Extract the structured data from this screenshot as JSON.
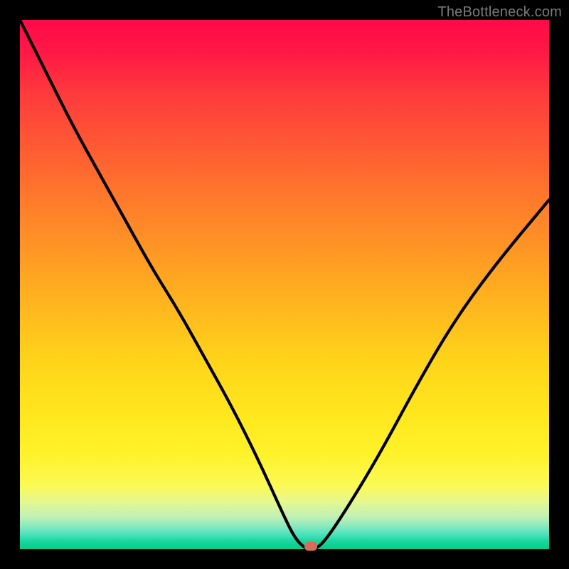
{
  "watermark": "TheBottleneck.com",
  "chart_data": {
    "type": "line",
    "title": "",
    "xlabel": "",
    "ylabel": "",
    "xlim": [
      0,
      1
    ],
    "ylim": [
      0,
      1
    ],
    "grid": false,
    "series": [
      {
        "name": "curve",
        "description": "V-shaped bottleneck curve; minimum near x≈0.54",
        "x": [
          0.0,
          0.05,
          0.1,
          0.15,
          0.2,
          0.25,
          0.3,
          0.35,
          0.4,
          0.45,
          0.5,
          0.52,
          0.54,
          0.56,
          0.58,
          0.62,
          0.68,
          0.75,
          0.82,
          0.9,
          1.0
        ],
        "y": [
          1.0,
          0.9,
          0.8,
          0.71,
          0.62,
          0.53,
          0.45,
          0.36,
          0.27,
          0.17,
          0.06,
          0.02,
          0.0,
          0.0,
          0.02,
          0.08,
          0.18,
          0.31,
          0.43,
          0.54,
          0.66
        ]
      }
    ],
    "marker": {
      "x": 0.55,
      "y": 0.0
    },
    "colors": {
      "curve": "#000000",
      "marker": "#d86b5e",
      "gradient_top": "#ff0a49",
      "gradient_bottom": "#00cf8c",
      "frame": "#000000"
    }
  }
}
